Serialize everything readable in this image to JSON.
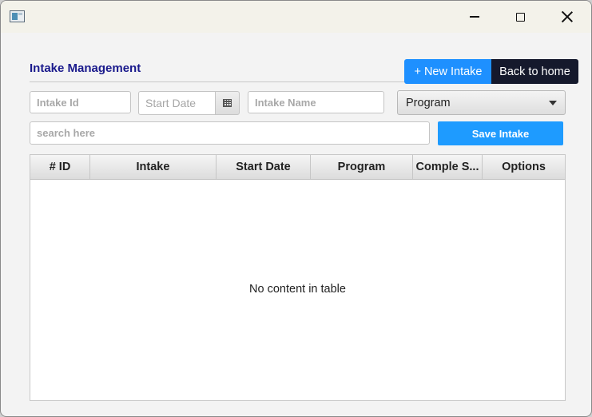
{
  "window": {
    "controls": {
      "minimize": "minimize-icon",
      "maximize": "maximize-icon",
      "close": "close-icon"
    }
  },
  "header": {
    "title": "Intake Management",
    "new_intake_label": "+ New Intake",
    "back_home_label": "Back to home"
  },
  "form": {
    "intake_id_placeholder": "Intake Id",
    "start_date_placeholder": "Start Date",
    "intake_name_placeholder": "Intake Name",
    "program_selected": "Program",
    "search_placeholder": "search here",
    "save_label": "Save Intake"
  },
  "table": {
    "columns": [
      "# ID",
      "Intake",
      "Start Date",
      "Program",
      "Comple S...",
      "Options"
    ],
    "rows": [],
    "empty_message": "No content in table"
  },
  "colors": {
    "accent": "#1e90ff",
    "dark_button": "#15192c",
    "title": "#1a1a8c"
  }
}
